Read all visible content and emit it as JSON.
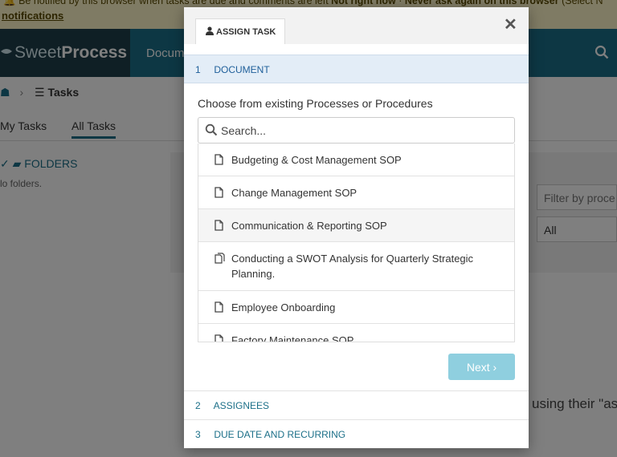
{
  "notify_bar": {
    "line1": "Be notified by this browser when tasks are due and comments are left",
    "not_now": "Not right now",
    "never": "Never ask again on this browser",
    "select_hint": "(Select N",
    "link": "notifications"
  },
  "navbar": {
    "brand_light": "Sweet",
    "brand_bold": "Process",
    "nav_documents": "Docume"
  },
  "breadcrumb": {
    "tasks": "Tasks"
  },
  "page_tabs": [
    {
      "label": "My Tasks"
    },
    {
      "label": "All Tasks"
    }
  ],
  "folders": {
    "label": "FOLDERS",
    "empty": "lo folders."
  },
  "filter": {
    "label": "Filter by proce",
    "value": "All"
  },
  "background_text": "using their \"as",
  "modal": {
    "tab_label": "ASSIGN TASK",
    "close_symbol": "✕",
    "steps": [
      {
        "num": "1",
        "label": "DOCUMENT"
      },
      {
        "num": "2",
        "label": "ASSIGNEES"
      },
      {
        "num": "3",
        "label": "DUE DATE AND RECURRING"
      }
    ],
    "choose_label": "Choose from existing Processes or Procedures",
    "search": {
      "placeholder": "Search...",
      "value": ""
    },
    "items": [
      {
        "label": "Budgeting & Cost Management SOP",
        "icon": "document-icon"
      },
      {
        "label": "Change Management SOP",
        "icon": "document-icon"
      },
      {
        "label": "Communication & Reporting SOP",
        "icon": "document-icon"
      },
      {
        "label": "Conducting a SWOT Analysis for Quarterly Strategic Planning.",
        "icon": "procedure-icon"
      },
      {
        "label": "Employee Onboarding",
        "icon": "document-icon"
      },
      {
        "label": "Factory Maintenance SOP",
        "icon": "document-icon"
      }
    ],
    "next_label": "Next ›"
  },
  "colors": {
    "brand": "#1b6f88",
    "step_active_bg": "#e3edf7",
    "next_button": "#8fcfdf"
  }
}
